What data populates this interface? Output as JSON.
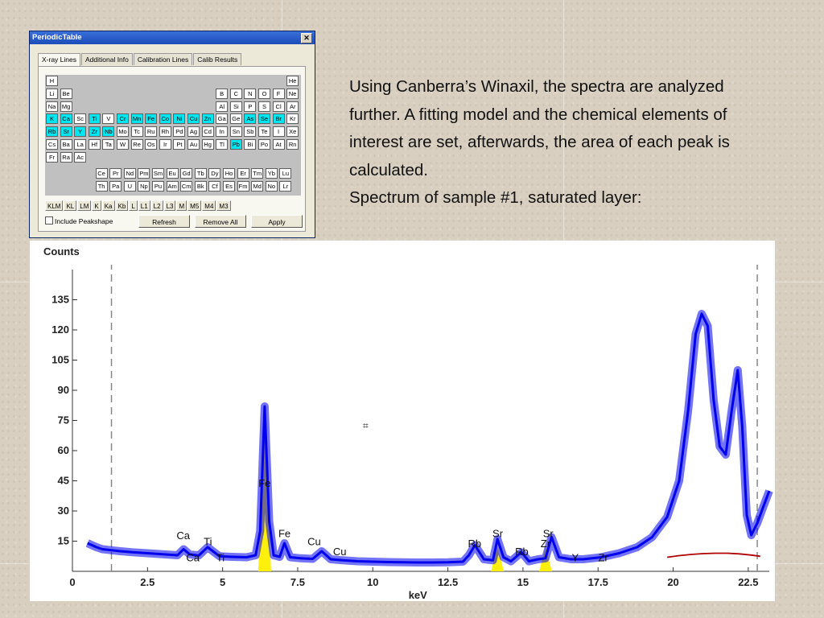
{
  "window": {
    "title": "PeriodicTable",
    "close_glyph": "✕",
    "tabs": [
      {
        "label": "X-ray Lines",
        "active": true
      },
      {
        "label": "Additional Info",
        "active": false
      },
      {
        "label": "Calibration Lines",
        "active": false
      },
      {
        "label": "Calib Results",
        "active": false
      }
    ],
    "elements": [
      {
        "s": "H",
        "r": 0,
        "c": 0
      },
      {
        "s": "He",
        "r": 0,
        "c": 17
      },
      {
        "s": "Li",
        "r": 1,
        "c": 0
      },
      {
        "s": "Be",
        "r": 1,
        "c": 1
      },
      {
        "s": "B",
        "r": 1,
        "c": 12
      },
      {
        "s": "C",
        "r": 1,
        "c": 13
      },
      {
        "s": "N",
        "r": 1,
        "c": 14
      },
      {
        "s": "O",
        "r": 1,
        "c": 15
      },
      {
        "s": "F",
        "r": 1,
        "c": 16
      },
      {
        "s": "Ne",
        "r": 1,
        "c": 17
      },
      {
        "s": "Na",
        "r": 2,
        "c": 0
      },
      {
        "s": "Mg",
        "r": 2,
        "c": 1
      },
      {
        "s": "Al",
        "r": 2,
        "c": 12
      },
      {
        "s": "Si",
        "r": 2,
        "c": 13
      },
      {
        "s": "P",
        "r": 2,
        "c": 14
      },
      {
        "s": "S",
        "r": 2,
        "c": 15
      },
      {
        "s": "Cl",
        "r": 2,
        "c": 16
      },
      {
        "s": "Ar",
        "r": 2,
        "c": 17
      },
      {
        "s": "K",
        "r": 3,
        "c": 0,
        "sel": true
      },
      {
        "s": "Ca",
        "r": 3,
        "c": 1,
        "sel": true
      },
      {
        "s": "Sc",
        "r": 3,
        "c": 2
      },
      {
        "s": "Ti",
        "r": 3,
        "c": 3,
        "sel": true
      },
      {
        "s": "V",
        "r": 3,
        "c": 4
      },
      {
        "s": "Cr",
        "r": 3,
        "c": 5,
        "sel": true
      },
      {
        "s": "Mn",
        "r": 3,
        "c": 6,
        "sel": true
      },
      {
        "s": "Fe",
        "r": 3,
        "c": 7,
        "sel": true
      },
      {
        "s": "Co",
        "r": 3,
        "c": 8,
        "sel": true
      },
      {
        "s": "Ni",
        "r": 3,
        "c": 9,
        "sel": true
      },
      {
        "s": "Cu",
        "r": 3,
        "c": 10,
        "sel": true
      },
      {
        "s": "Zn",
        "r": 3,
        "c": 11,
        "sel": true
      },
      {
        "s": "Ga",
        "r": 3,
        "c": 12
      },
      {
        "s": "Ge",
        "r": 3,
        "c": 13
      },
      {
        "s": "As",
        "r": 3,
        "c": 14,
        "sel": true
      },
      {
        "s": "Se",
        "r": 3,
        "c": 15,
        "sel": true
      },
      {
        "s": "Br",
        "r": 3,
        "c": 16,
        "sel": true
      },
      {
        "s": "Kr",
        "r": 3,
        "c": 17
      },
      {
        "s": "Rb",
        "r": 4,
        "c": 0,
        "sel": true
      },
      {
        "s": "Sr",
        "r": 4,
        "c": 1,
        "sel": true
      },
      {
        "s": "Y",
        "r": 4,
        "c": 2,
        "sel": true
      },
      {
        "s": "Zr",
        "r": 4,
        "c": 3,
        "sel": true
      },
      {
        "s": "Nb",
        "r": 4,
        "c": 4,
        "sel": true
      },
      {
        "s": "Mo",
        "r": 4,
        "c": 5
      },
      {
        "s": "Tc",
        "r": 4,
        "c": 6
      },
      {
        "s": "Ru",
        "r": 4,
        "c": 7
      },
      {
        "s": "Rh",
        "r": 4,
        "c": 8
      },
      {
        "s": "Pd",
        "r": 4,
        "c": 9
      },
      {
        "s": "Ag",
        "r": 4,
        "c": 10
      },
      {
        "s": "Cd",
        "r": 4,
        "c": 11
      },
      {
        "s": "In",
        "r": 4,
        "c": 12
      },
      {
        "s": "Sn",
        "r": 4,
        "c": 13
      },
      {
        "s": "Sb",
        "r": 4,
        "c": 14
      },
      {
        "s": "Te",
        "r": 4,
        "c": 15
      },
      {
        "s": "I",
        "r": 4,
        "c": 16
      },
      {
        "s": "Xe",
        "r": 4,
        "c": 17
      },
      {
        "s": "Cs",
        "r": 5,
        "c": 0
      },
      {
        "s": "Ba",
        "r": 5,
        "c": 1
      },
      {
        "s": "La",
        "r": 5,
        "c": 2
      },
      {
        "s": "Hf",
        "r": 5,
        "c": 3
      },
      {
        "s": "Ta",
        "r": 5,
        "c": 4
      },
      {
        "s": "W",
        "r": 5,
        "c": 5
      },
      {
        "s": "Re",
        "r": 5,
        "c": 6
      },
      {
        "s": "Os",
        "r": 5,
        "c": 7
      },
      {
        "s": "Ir",
        "r": 5,
        "c": 8
      },
      {
        "s": "Pt",
        "r": 5,
        "c": 9
      },
      {
        "s": "Au",
        "r": 5,
        "c": 10
      },
      {
        "s": "Hg",
        "r": 5,
        "c": 11
      },
      {
        "s": "Tl",
        "r": 5,
        "c": 12
      },
      {
        "s": "Pb",
        "r": 5,
        "c": 13,
        "sel": true
      },
      {
        "s": "Bi",
        "r": 5,
        "c": 14
      },
      {
        "s": "Po",
        "r": 5,
        "c": 15
      },
      {
        "s": "At",
        "r": 5,
        "c": 16
      },
      {
        "s": "Rn",
        "r": 5,
        "c": 17
      },
      {
        "s": "Fr",
        "r": 6,
        "c": 0
      },
      {
        "s": "Ra",
        "r": 6,
        "c": 1
      },
      {
        "s": "Ac",
        "r": 6,
        "c": 2
      },
      {
        "s": "Ce",
        "r": 7.3,
        "c": 3.5
      },
      {
        "s": "Pr",
        "r": 7.3,
        "c": 4.5
      },
      {
        "s": "Nd",
        "r": 7.3,
        "c": 5.5
      },
      {
        "s": "Pm",
        "r": 7.3,
        "c": 6.5
      },
      {
        "s": "Sm",
        "r": 7.3,
        "c": 7.5
      },
      {
        "s": "Eu",
        "r": 7.3,
        "c": 8.5
      },
      {
        "s": "Gd",
        "r": 7.3,
        "c": 9.5
      },
      {
        "s": "Tb",
        "r": 7.3,
        "c": 10.5
      },
      {
        "s": "Dy",
        "r": 7.3,
        "c": 11.5
      },
      {
        "s": "Ho",
        "r": 7.3,
        "c": 12.5
      },
      {
        "s": "Er",
        "r": 7.3,
        "c": 13.5
      },
      {
        "s": "Tm",
        "r": 7.3,
        "c": 14.5
      },
      {
        "s": "Yb",
        "r": 7.3,
        "c": 15.5
      },
      {
        "s": "Lu",
        "r": 7.3,
        "c": 16.5
      },
      {
        "s": "Th",
        "r": 8.3,
        "c": 3.5
      },
      {
        "s": "Pa",
        "r": 8.3,
        "c": 4.5
      },
      {
        "s": "U",
        "r": 8.3,
        "c": 5.5
      },
      {
        "s": "Np",
        "r": 8.3,
        "c": 6.5
      },
      {
        "s": "Pu",
        "r": 8.3,
        "c": 7.5
      },
      {
        "s": "Am",
        "r": 8.3,
        "c": 8.5
      },
      {
        "s": "Cm",
        "r": 8.3,
        "c": 9.5
      },
      {
        "s": "Bk",
        "r": 8.3,
        "c": 10.5
      },
      {
        "s": "Cf",
        "r": 8.3,
        "c": 11.5
      },
      {
        "s": "Es",
        "r": 8.3,
        "c": 12.5
      },
      {
        "s": "Fm",
        "r": 8.3,
        "c": 13.5
      },
      {
        "s": "Md",
        "r": 8.3,
        "c": 14.5
      },
      {
        "s": "No",
        "r": 8.3,
        "c": 15.5
      },
      {
        "s": "Lr",
        "r": 8.3,
        "c": 16.5
      }
    ],
    "line_buttons": [
      "KLM",
      "KL",
      "LM",
      "K",
      "Ka",
      "Kb",
      "L",
      "L1",
      "L2",
      "L3",
      "M",
      "M5",
      "M4",
      "M3"
    ],
    "include_peakshape_label": "Include Peakshape",
    "refresh_label": "Refresh",
    "remove_all_label": "Remove All",
    "apply_label": "Apply"
  },
  "text": {
    "paragraph1": "Using Canberra’s Winaxil, the spectra are analyzed further. A fitting model and the chemical elements of interest are set, afterwards, the area of each peak is calculated.",
    "paragraph2": "Spectrum of sample #1, saturated layer:"
  },
  "chart_data": {
    "type": "line",
    "title": "",
    "xlabel": "keV",
    "ylabel": "Counts",
    "xlim": [
      0,
      23.2
    ],
    "ylim": [
      0,
      150
    ],
    "x_ticks": [
      "0",
      "2.5",
      "5",
      "7.5",
      "10",
      "12.5",
      "15",
      "17.5",
      "20",
      "22.5"
    ],
    "y_ticks": [
      "15",
      "30",
      "45",
      "60",
      "75",
      "90",
      "105",
      "120",
      "135"
    ],
    "region_markers_kev": [
      1.3,
      22.8
    ],
    "series": [
      {
        "color": "#0000ee",
        "x": [
          0.5,
          0.8,
          1.0,
          1.3,
          1.6,
          2.0,
          2.5,
          3.0,
          3.5,
          3.7,
          3.9,
          4.2,
          4.5,
          4.9,
          5.3,
          5.8,
          6.1,
          6.25,
          6.4,
          6.55,
          6.7,
          6.9,
          7.06,
          7.25,
          7.6,
          8.0,
          8.3,
          8.6,
          9.0,
          9.5,
          10.0,
          10.5,
          11.0,
          11.5,
          12.0,
          12.5,
          13.0,
          13.2,
          13.4,
          13.7,
          14.0,
          14.15,
          14.35,
          14.6,
          14.95,
          15.2,
          15.5,
          15.75,
          15.95,
          16.2,
          16.6,
          17.0,
          17.6,
          18.2,
          18.8,
          19.3,
          19.8,
          20.2,
          20.5,
          20.75,
          20.95,
          21.15,
          21.35,
          21.55,
          21.75,
          21.95,
          22.15,
          22.3,
          22.45,
          22.6,
          22.8,
          23.0,
          23.2
        ],
        "y": [
          14,
          12,
          11,
          10.5,
          10,
          9.5,
          9,
          8.5,
          8,
          11,
          8.5,
          7.8,
          12,
          7.5,
          7.2,
          7,
          8,
          20,
          82,
          25,
          8,
          7.2,
          14,
          7,
          6.5,
          6.2,
          10,
          6,
          5.5,
          5,
          4.8,
          4.6,
          4.5,
          4.4,
          4.4,
          4.5,
          4.8,
          8,
          13,
          6,
          5.5,
          16,
          7,
          5,
          9.5,
          5,
          6,
          6.5,
          17,
          7,
          6,
          6,
          7,
          9,
          12,
          17,
          27,
          45,
          80,
          118,
          128,
          122,
          85,
          62,
          58,
          80,
          100,
          72,
          28,
          18,
          24,
          32,
          40
        ]
      },
      {
        "color": "#b00000",
        "x": [
          19.8,
          20.2,
          20.6,
          21.0,
          21.4,
          21.8,
          22.2,
          22.6,
          22.9
        ],
        "y": [
          7,
          7.8,
          8.4,
          8.8,
          9.0,
          9.0,
          8.7,
          8.1,
          7.5
        ]
      }
    ],
    "yellow_peaks_kev": [
      6.4,
      14.15,
      15.75
    ],
    "annotations": [
      {
        "label": "Ca",
        "x": 3.69,
        "y": 16
      },
      {
        "label": "Ca",
        "x": 4.01,
        "y": 5
      },
      {
        "label": "Ti",
        "x": 4.51,
        "y": 13
      },
      {
        "label": "Ti",
        "x": 4.93,
        "y": 5
      },
      {
        "label": "Fe",
        "x": 6.4,
        "y": 42
      },
      {
        "label": "Fe",
        "x": 7.06,
        "y": 17
      },
      {
        "label": "Cu",
        "x": 8.05,
        "y": 13
      },
      {
        "label": "Cu",
        "x": 8.9,
        "y": 8
      },
      {
        "label": "Rb",
        "x": 13.39,
        "y": 12
      },
      {
        "label": "Sr",
        "x": 14.16,
        "y": 17
      },
      {
        "label": "Rb",
        "x": 14.96,
        "y": 8
      },
      {
        "label": "Sr",
        "x": 15.84,
        "y": 17
      },
      {
        "label": "Zr",
        "x": 15.75,
        "y": 12
      },
      {
        "label": "Y",
        "x": 16.74,
        "y": 5
      },
      {
        "label": "Zr",
        "x": 17.67,
        "y": 5
      }
    ]
  }
}
